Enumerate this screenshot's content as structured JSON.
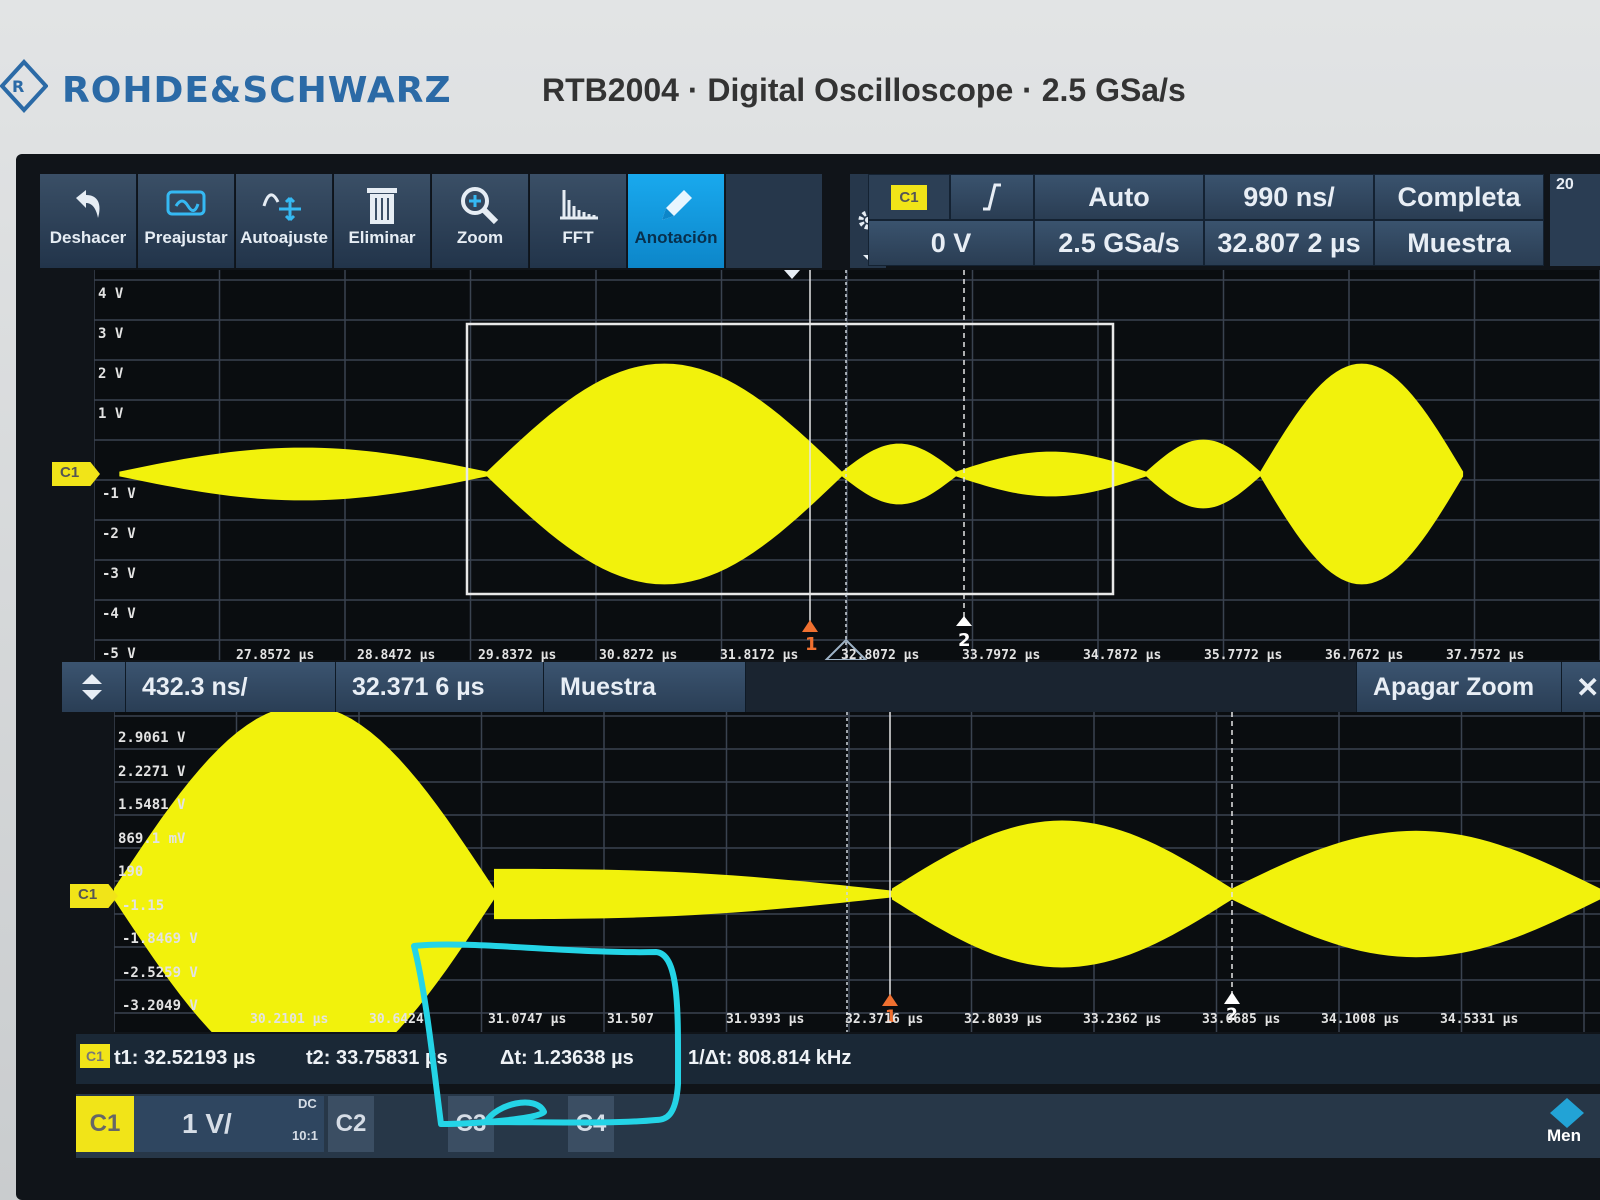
{
  "brand": {
    "name": "ROHDE&SCHWARZ",
    "model": "RTB2004 · Digital Oscilloscope · 2.5 GSa/s"
  },
  "toolbar": {
    "buttons": [
      {
        "label": "Deshacer",
        "icon": "undo-icon"
      },
      {
        "label": "Preajustar",
        "icon": "preset-icon"
      },
      {
        "label": "Autoajuste",
        "icon": "autoset-icon"
      },
      {
        "label": "Eliminar",
        "icon": "trash-icon"
      },
      {
        "label": "Zoom",
        "icon": "zoom-icon"
      },
      {
        "label": "FFT",
        "icon": "fft-icon"
      },
      {
        "label": "Anotación",
        "icon": "pencil-icon",
        "active": true
      }
    ]
  },
  "trigger": {
    "source": "C1",
    "slope_icon": "rising-edge-icon",
    "level": "0 V",
    "mode": "Auto",
    "sample_rate": "2.5 GSa/s"
  },
  "timebase": {
    "scale": "990 ns/",
    "position": "32.807 2 µs"
  },
  "acquisition": {
    "mode": "Completa",
    "type": "Muestra"
  },
  "corner_label": "20",
  "main_plot": {
    "channel": "C1",
    "y_labels": [
      "4 V",
      "3 V",
      "2 V",
      "1 V",
      "-1 V",
      "-2 V",
      "-3 V",
      "-4 V",
      "-5 V"
    ],
    "x_labels": [
      "27.8572 µs",
      "28.8472 µs",
      "29.8372 µs",
      "30.8272 µs",
      "31.8172 µs",
      "32.8072 µs",
      "33.7972 µs",
      "34.7872 µs",
      "35.7772 µs",
      "36.7672 µs",
      "37.7572 µs"
    ],
    "cursor1_label": "1",
    "cursor2_label": "2",
    "envelope_nodes_us": [
      26.9,
      29.8,
      32.6,
      33.5,
      35.0,
      35.9,
      37.5
    ],
    "envelope_peaks_v": [
      0.6,
      2.7,
      0.7,
      0.5,
      0.8,
      2.7,
      0.9
    ]
  },
  "zoom_bar": {
    "scale": "432.3 ns/",
    "position": "32.371 6 µs",
    "mode": "Muestra",
    "close_label": "Apagar Zoom",
    "close_icon": "close-icon",
    "updown_icon": "up-down-arrows-icon"
  },
  "zoom_plot": {
    "channel": "C1",
    "y_labels": [
      "2.9061 V",
      "2.2271 V",
      "1.5481 V",
      "869.1 mV",
      "190",
      "-1.15",
      "-1.8469 V",
      "-2.5259 V",
      "-3.2049 V"
    ],
    "x_labels": [
      "30.2101 µs",
      "30.6424",
      "31.0747 µs",
      "31.507",
      "31.9393 µs",
      "32.3716 µs",
      "32.8039 µs",
      "33.2362 µs",
      "33.6685 µs",
      "34.1008 µs",
      "34.5331 µs"
    ],
    "cursor1_label": "1",
    "cursor2_label": "2"
  },
  "measurements": {
    "tag": "C1",
    "t1": "t1: 32.52193 µs",
    "t2": "t2: 33.75831 µs",
    "dt": "Δt: 1.23638 µs",
    "inv_dt": "1/Δt: 808.814 kHz"
  },
  "channels": {
    "c1": "C1",
    "c1_scale": "1 V/",
    "c1_coupling": "DC",
    "c1_probe": "10:1",
    "c2": "C2",
    "c3": "C3",
    "c4": "C4",
    "menu": "Men"
  },
  "colors": {
    "trace": "#f2f20c",
    "annotation": "#24d4e6",
    "active": "#12a3e8",
    "cursor1": "#f07030"
  }
}
